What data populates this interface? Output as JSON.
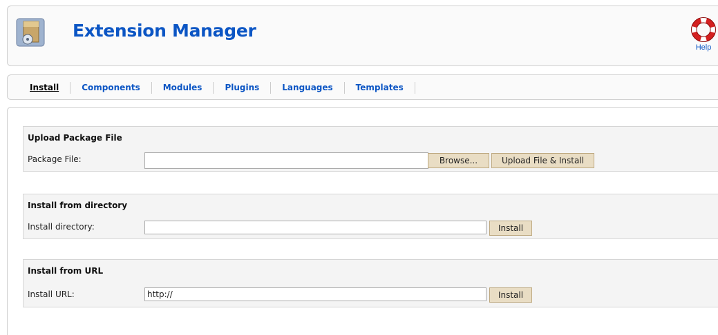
{
  "header": {
    "title": "Extension Manager",
    "help_label": "Help"
  },
  "submenu": {
    "items": [
      {
        "label": "Install",
        "active": true
      },
      {
        "label": "Components"
      },
      {
        "label": "Modules"
      },
      {
        "label": "Plugins"
      },
      {
        "label": "Languages"
      },
      {
        "label": "Templates"
      }
    ]
  },
  "upload": {
    "title": "Upload Package File",
    "label": "Package File:",
    "value": "",
    "browse_label": "Browse...",
    "submit_label": "Upload File & Install"
  },
  "directory": {
    "title": "Install from directory",
    "label": "Install directory:",
    "value": "",
    "submit_label": "Install"
  },
  "url": {
    "title": "Install from URL",
    "label": "Install URL:",
    "value": "http://",
    "submit_label": "Install"
  },
  "colors": {
    "link": "#0b55c4",
    "button_bg": "#e9ddc4",
    "panel_bg": "#f4f4f4"
  }
}
